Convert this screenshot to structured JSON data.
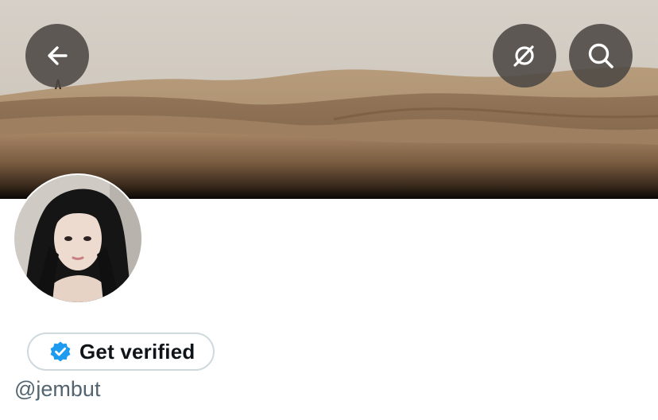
{
  "header": {
    "back_icon": "arrow-left-icon",
    "grok_icon": "grok-slash-icon",
    "search_icon": "search-icon",
    "banner_image": "desert-dunes"
  },
  "profile": {
    "avatar_image": "profile-photo",
    "get_verified_label": "Get verified",
    "verified_badge_icon": "verified-badge-icon",
    "verified_badge_color": "#1d9bf0",
    "handle": "@jembut"
  },
  "colors": {
    "header_button_bg": "#4c4844",
    "text_primary": "#0f1419",
    "text_secondary": "#536471",
    "button_border": "#cfd9de"
  }
}
